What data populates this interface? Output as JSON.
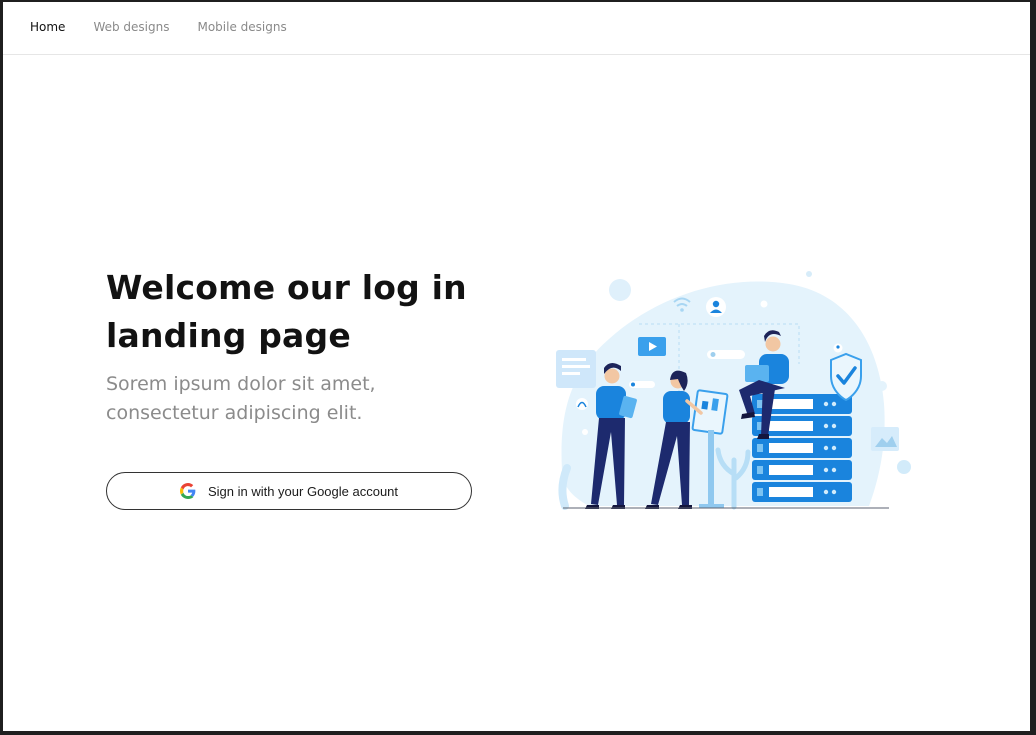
{
  "nav": {
    "items": [
      {
        "label": "Home",
        "active": true
      },
      {
        "label": "Web designs",
        "active": false
      },
      {
        "label": "Mobile designs",
        "active": false
      }
    ]
  },
  "hero": {
    "title": "Welcome our log in\nlanding page",
    "subtitle": "Sorem ipsum dolor sit amet,\nconsectetur adipiscing elit.",
    "button_label": "Sign in with your Google account",
    "button_icon": "google-icon"
  },
  "illustration": {
    "icon": "team-security-illustration"
  },
  "colors": {
    "accent": "#1677d3",
    "light_blue": "#dff0fb",
    "navy": "#1e2f7a",
    "text_dark": "#121212",
    "text_muted": "#8b8b8b",
    "border": "#333333"
  }
}
